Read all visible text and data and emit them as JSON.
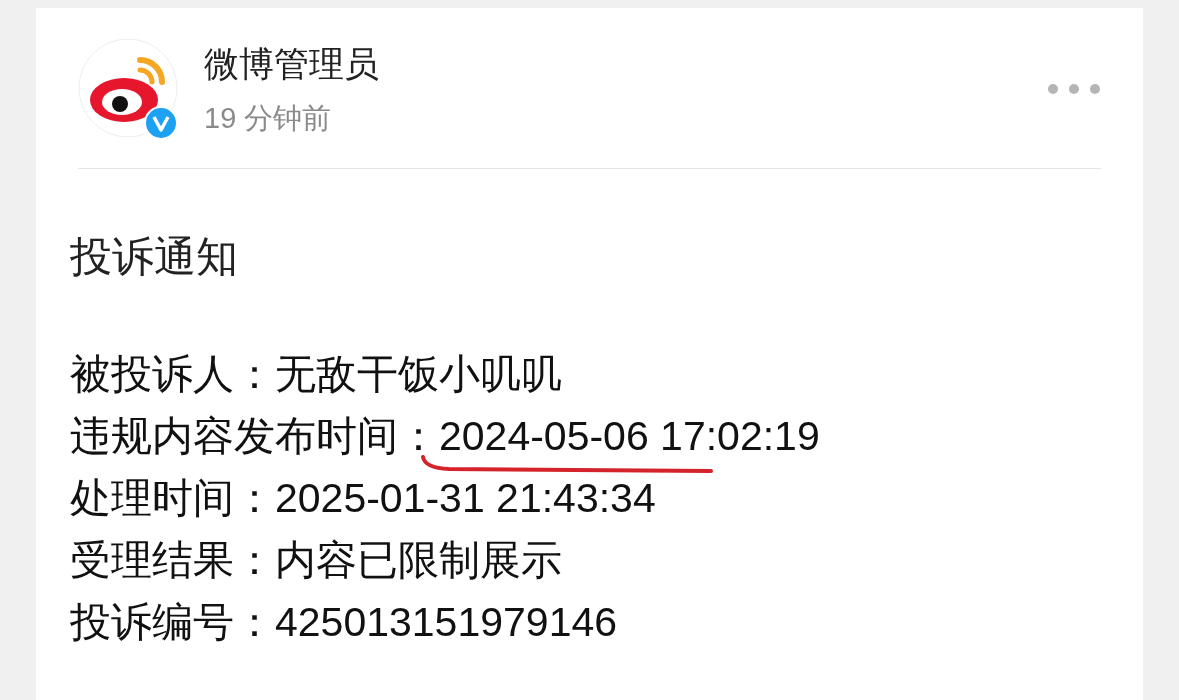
{
  "post": {
    "author": "微博管理员",
    "time": "19 分钟前",
    "verified": true
  },
  "notice": {
    "title": "投诉通知",
    "rows": [
      {
        "label": "被投诉人：",
        "value": "无敌干饭小叽叽",
        "underlined": false
      },
      {
        "label": "违规内容发布时间：",
        "value": "2024-05-06 17:02:19",
        "underlined": true
      },
      {
        "label": "处理时间：",
        "value": "2025-01-31 21:43:34",
        "underlined": false
      },
      {
        "label": "受理结果：",
        "value": "内容已限制展示",
        "underlined": false
      },
      {
        "label": "投诉编号：",
        "value": "425013151979146",
        "underlined": false
      }
    ]
  }
}
